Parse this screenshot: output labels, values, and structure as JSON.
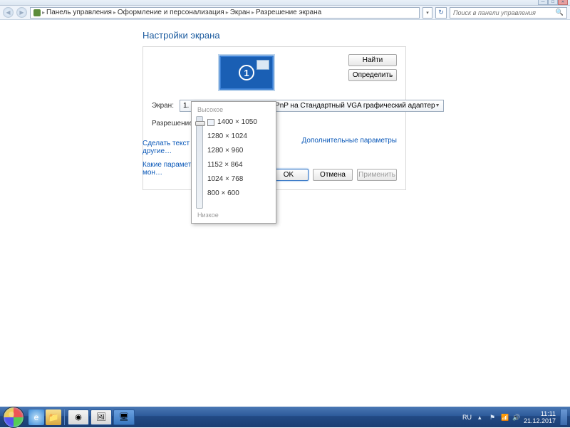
{
  "breadcrumb": {
    "root_icon": "control-panel-icon",
    "items": [
      "Панель управления",
      "Оформление и персонализация",
      "Экран",
      "Разрешение экрана"
    ]
  },
  "search": {
    "placeholder": "Поиск в панели управления"
  },
  "page": {
    "title": "Настройки экрана",
    "find_btn": "Найти",
    "detect_btn": "Определить",
    "screen_label": "Экран:",
    "screen_value": "1. Универсальный монитор PnP на Стандартный VGA графический адаптер",
    "resolution_label": "Разрешение:",
    "resolution_value": "1400 × 1050",
    "monitor_number": "1",
    "advanced_link": "Дополнительные параметры",
    "ok": "OK",
    "cancel": "Отмена",
    "apply": "Применить"
  },
  "help_links": {
    "a": "Сделать текст и другие…",
    "b": "Какие параметры мон…"
  },
  "res_popup": {
    "high": "Высокое",
    "low": "Низкое",
    "options": [
      "1400 × 1050",
      "1280 × 1024",
      "1280 × 960",
      "1152 × 864",
      "1024 × 768",
      "800 × 600"
    ]
  },
  "tray": {
    "lang": "RU",
    "time": "11:11",
    "date": "21.12.2017"
  }
}
